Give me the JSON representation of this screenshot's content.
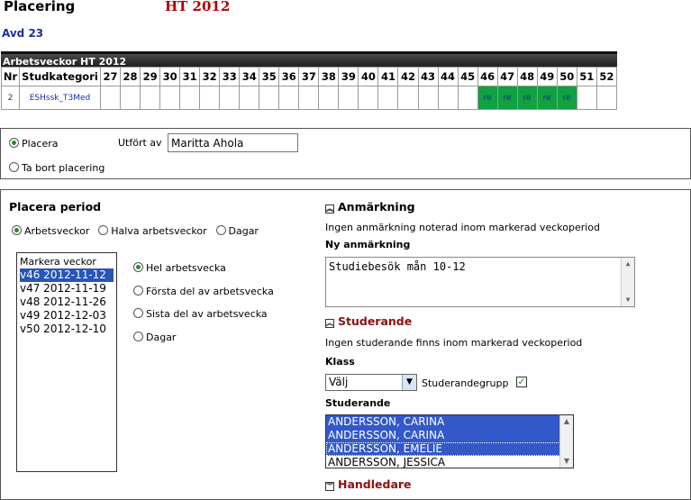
{
  "header": {
    "title": "Placering",
    "term": "HT 2012",
    "department": "Avd 23"
  },
  "week_table": {
    "caption": "Arbetsveckor HT 2012",
    "col_nr": "Nr",
    "col_category": "Studkategori",
    "weeks": [
      "27",
      "28",
      "29",
      "30",
      "31",
      "32",
      "33",
      "34",
      "35",
      "36",
      "37",
      "38",
      "39",
      "40",
      "41",
      "42",
      "43",
      "44",
      "45",
      "46",
      "47",
      "48",
      "49",
      "50",
      "51",
      "52"
    ],
    "rows": [
      {
        "nr": "2",
        "category": "ESHssk_T3Med",
        "cells": {
          "46": "re",
          "47": "re",
          "48": "re",
          "49": "re",
          "50": "re"
        }
      }
    ],
    "placed_color": "#12a040"
  },
  "action": {
    "place_label": "Placera",
    "remove_label": "Ta bort placering",
    "performed_by_label": "Utfört av",
    "performed_by_value": "Maritta Ahola",
    "selected": "place"
  },
  "period": {
    "title": "Placera period",
    "options": [
      "Arbetsveckor",
      "Halva arbetsveckor",
      "Dagar"
    ],
    "selected": "Arbetsveckor",
    "mark_weeks_label": "Markera veckor",
    "weeks": [
      "v46 2012-11-12",
      "v47 2012-11-19",
      "v48 2012-11-26",
      "v49 2012-12-03",
      "v50 2012-12-10"
    ],
    "selected_week": "v46 2012-11-12",
    "part_options": [
      "Hel arbetsvecka",
      "Första del av arbetsvecka",
      "Sista del av arbetsvecka",
      "Dagar"
    ],
    "selected_part": "Hel arbetsvecka"
  },
  "remark": {
    "title": "Anmärkning",
    "info": "Ingen anmärkning noterad inom markerad veckoperiod",
    "new_label": "Ny anmärkning",
    "new_value": "Studiebesök mån 10-12"
  },
  "students": {
    "title": "Studerande",
    "info": "Ingen studerande finns inom markerad veckoperiod",
    "class_label": "Klass",
    "class_value": "Välj",
    "group_label": "Studerandegrupp",
    "list_label": "Studerande",
    "list": [
      "ANDERSSON, CARINA",
      "ANDERSSON, CARINA",
      "ANDERSSON, EMELIE",
      "ANDERSSON, JESSICA"
    ]
  },
  "supervisor": {
    "title": "Handledare"
  }
}
